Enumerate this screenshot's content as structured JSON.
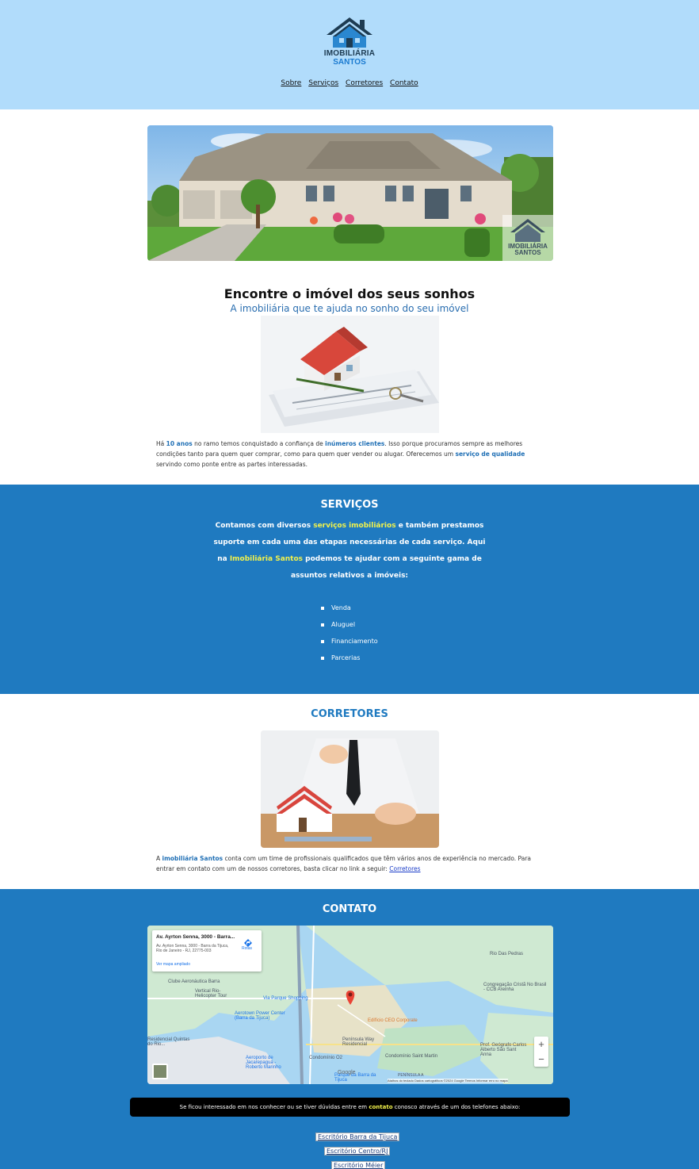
{
  "header": {
    "logo_line1": "IMOBILIÁRIA",
    "logo_line2": "SANTOS",
    "nav": [
      "Sobre",
      "Serviços",
      "Corretores",
      "Contato"
    ]
  },
  "hero": {
    "watermark_line1": "IMOBILIÁRIA",
    "watermark_line2": "SANTOS"
  },
  "intro": {
    "title": "Encontre o imóvel dos seus sonhos",
    "subtitle": "A imobiliária que te ajuda no sonho do seu imóvel",
    "text_1": "Há ",
    "hl_1": "10 anos",
    "text_2": " no ramo temos conquistado a confiança de ",
    "hl_2": "inúmeros clientes",
    "text_3": ". Isso porque procuramos sempre as melhores condições tanto para quem quer comprar, como para quem quer vender ou alugar. Oferecemos um ",
    "hl_3": "serviço de qualidade",
    "text_4": " servindo como ponte entre as partes interessadas."
  },
  "services": {
    "title": "SERVIÇOS",
    "text_1": "Contamos com diversos ",
    "hl_1": "serviços imobiliários",
    "text_2": " e também prestamos suporte em cada uma das etapas necessárias de cada serviço. Aqui na ",
    "hl_2": "Imobiliária Santos",
    "text_3": " podemos te ajudar com a seguinte gama de assuntos relativos a imóveis:",
    "items": [
      "Venda",
      "Aluguel",
      "Financiamento",
      "Parcerias"
    ]
  },
  "corretores": {
    "title": "CORRETORES",
    "text_1": "A ",
    "hl_1": "imobiliária Santos",
    "text_2": " conta com um time de profissionais qualificados que têm vários anos de experiência no mercado. Para entrar em contato com um de nossos corretores, basta clicar no link a seguir: ",
    "link": "Corretores"
  },
  "contato": {
    "title": "CONTATO",
    "map": {
      "card_title": "Av. Ayrton Senna, 3000 - Barra...",
      "card_address": "Av. Ayrton Senna, 3000 - Barra da Tijuca, Rio de Janeiro - RJ, 22775-003",
      "card_link": "Ver mapa ampliado",
      "route": "Rotas",
      "zoom_in": "+",
      "zoom_out": "−",
      "google": "Google",
      "footer": "Atalhos do teclado   Dados cartográficos ©2024 Google   Termos   Informar erro no mapa",
      "labels": {
        "clube": "Clube Aeronáutica Barra",
        "vertical": "Vertical Rio-Helicopter Tour",
        "via_parque": "Via Parque Shopping",
        "aerotown": "Aerotown Power Center (Barra da Tijuca)",
        "ceo": "Edifício CEO Corporate",
        "residencial": "Residencial Quintas do Rio...",
        "aeroporto": "Aeroporto de Jacarepaguá - Roberto Marinho",
        "condominio_o2": "Condomínio O2",
        "peninsula_way": "Península Way Residencial",
        "saint_martin": "Condomínio Saint Martin",
        "rio_das_pedras": "Rio Das Pedras",
        "congregacao": "Congregação Cristã No Brasil - CCB Areinha",
        "geografo": "Prof. Geógrafo Carlos Alberto São Sant Anna",
        "parque_barra": "Parque da Barra da Tijuca",
        "peninsula": "PENÍNSULA A"
      }
    },
    "bar_text_1": "Se ficou interessado em nos conhecer ou se tiver dúvidas entre em ",
    "bar_hl": "contato",
    "bar_text_2": " conosco através de um dos telefones abaixo:",
    "offices": [
      "Escritório Barra da Tijuca",
      "Escritório Centro/RJ",
      "Escritório Méier"
    ]
  },
  "colors": {
    "header_bg": "#b1dcfb",
    "section_blue": "#1f7ac0",
    "highlight_yellow": "#f2f24b",
    "highlight_blue": "#1f6fb5"
  }
}
